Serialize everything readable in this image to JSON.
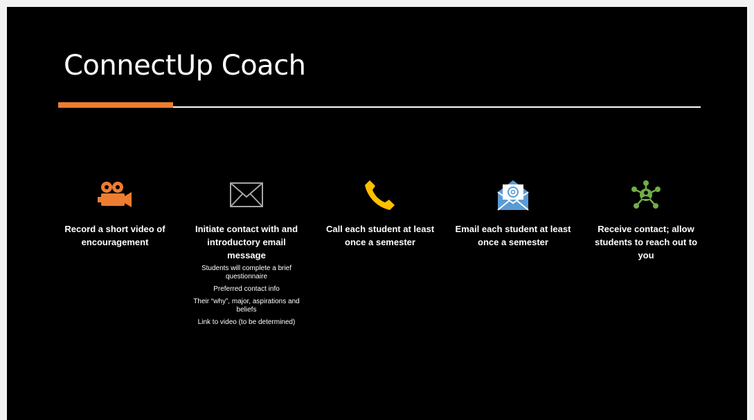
{
  "slide": {
    "title": "ConnectUp Coach",
    "accent_color": "#ed7d31"
  },
  "columns": [
    {
      "icon": "video-camera-icon",
      "icon_color": "#ed7d31",
      "heading": "Record a short video of encouragement",
      "details": []
    },
    {
      "icon": "envelope-icon",
      "icon_color": "#a6a6a6",
      "heading": "Initiate contact with and introductory email message",
      "details": [
        "Students will complete a brief questionnaire",
        "Preferred contact info",
        "Their “why”, major, aspirations and beliefs",
        "Link to video (to be determined)"
      ]
    },
    {
      "icon": "phone-icon",
      "icon_color": "#ffc000",
      "heading": "Call each student at least once a semester",
      "details": []
    },
    {
      "icon": "email-at-icon",
      "icon_color": "#5b9bd5",
      "heading": "Email each student at least once a semester",
      "details": []
    },
    {
      "icon": "network-icon",
      "icon_color": "#70ad47",
      "heading": "Receive contact; allow students to reach out to you",
      "details": []
    }
  ]
}
